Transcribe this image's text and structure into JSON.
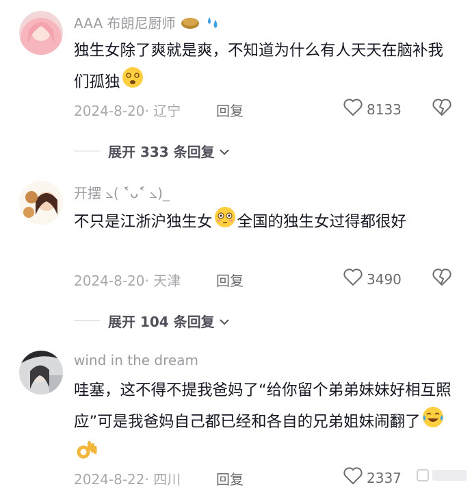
{
  "comments": [
    {
      "username": "AAA 布朗尼厨师",
      "text_a": "独生女除了爽就是爽，不知道为什么有人天天在脑补我们孤独",
      "text_b": "",
      "meta": "2024-8-20· 辽宁",
      "reply": "回复",
      "likes": "8133",
      "username_emojis": [
        "bread-emoji",
        "sweat-drops-emoji"
      ],
      "text_emojis": [
        "dizzy-face-emoji"
      ]
    },
    {
      "username": "开摆 ⦣( ˂̀ᴗ˂́ ⦣)_",
      "text_a": "不只是江浙沪独生女",
      "text_b": "全国的独生女过得都很好",
      "meta": "2024-8-20· 天津",
      "reply": "回复",
      "likes": "3490",
      "text_emojis": [
        "flushed-face-emoji"
      ]
    },
    {
      "username": "wind in the dream",
      "text_a": "哇塞，这不得不提我爸妈了“给你留个弟弟妹妹好相互照应”可是我爸妈自己都已经和各自的兄弟姐妹闹翻了",
      "text_b": "",
      "meta": "2024-8-22· 四川",
      "reply": "回复",
      "likes": "2337",
      "text_emojis": [
        "tears-of-joy-emoji",
        "ok-hand-emoji"
      ]
    }
  ],
  "expand_rows": [
    {
      "label": "展开 333 条回复"
    },
    {
      "label": "展开 104 条回复"
    }
  ],
  "colors": {
    "text": "#161823",
    "secondary": "#a8a8ad",
    "action": "#6b6b70"
  }
}
